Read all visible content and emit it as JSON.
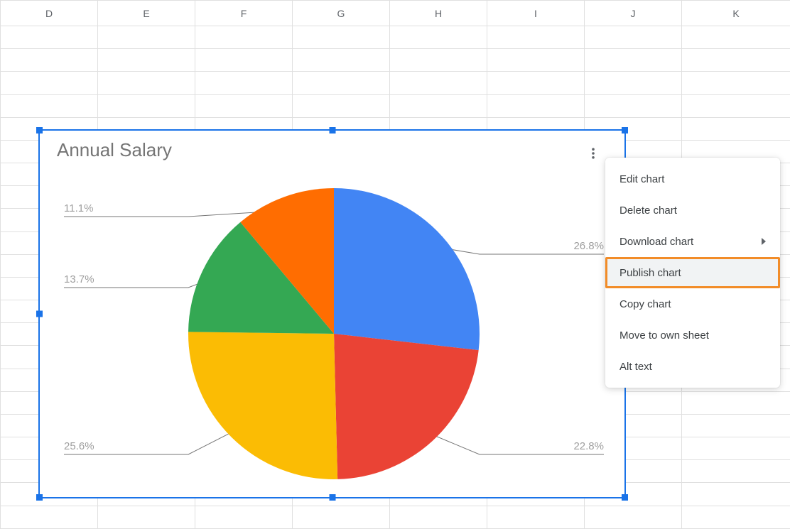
{
  "columns": [
    "D",
    "E",
    "F",
    "G",
    "H",
    "I",
    "J",
    "K"
  ],
  "chart": {
    "title": "Annual Salary",
    "menu": {
      "edit": "Edit chart",
      "delete": "Delete chart",
      "download": "Download chart",
      "publish": "Publish chart",
      "copy": "Copy chart",
      "move": "Move to own sheet",
      "alttext": "Alt text"
    }
  },
  "chart_data": {
    "type": "pie",
    "title": "Annual Salary",
    "slices": [
      {
        "label": "26.8%",
        "value": 26.8,
        "color": "#4285f4"
      },
      {
        "label": "22.8%",
        "value": 22.8,
        "color": "#ea4335"
      },
      {
        "label": "25.6%",
        "value": 25.6,
        "color": "#fbbc04"
      },
      {
        "label": "13.7%",
        "value": 13.7,
        "color": "#34a853"
      },
      {
        "label": "11.1%",
        "value": 11.1,
        "color": "#ff6d01"
      }
    ]
  },
  "colors": {
    "selection": "#1a73e8",
    "highlight_border": "#f28c28"
  }
}
